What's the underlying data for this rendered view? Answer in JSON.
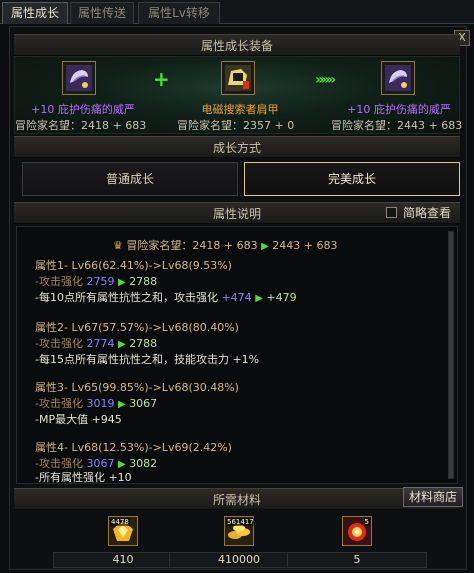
{
  "tabs": [
    {
      "label": "属性成长"
    },
    {
      "label": "属性传送"
    },
    {
      "label": "属性Lv转移"
    }
  ],
  "close_label": "X",
  "equip_section": {
    "title": "属性成长装备",
    "source": {
      "name": "+10 庇护伤痛的威严",
      "plus": "+10",
      "item": "庇护伤痛的威严",
      "fame": "冒险家名望：2418 + 683"
    },
    "material": {
      "name": "电磁搜索者肩甲",
      "fame": "冒险家名望：2357 + 0"
    },
    "result": {
      "name": "+10 庇护伤痛的威严",
      "plus": "+10",
      "item": "庇护伤痛的威严",
      "fame": "冒险家名望：2443 + 683"
    },
    "plus_sign": "+",
    "arrows": "»»»"
  },
  "growth_section": {
    "title": "成长方式",
    "normal_label": "普通成长",
    "perfect_label": "完美成长"
  },
  "desc_section": {
    "title": "属性说明",
    "brief_label": "简略查看",
    "fame_line": {
      "label": "冒险家名望：2418 + 683",
      "arrow": "▶",
      "after": "2443 + 683"
    },
    "attrs": [
      {
        "title": "属性1- Lv66(62.41%)->Lv68(9.53%)",
        "stat": "-攻击强化",
        "from": "2759",
        "to": "2788",
        "note": "-每10点所有属性抗性之和，攻击强化",
        "note_from": "+474",
        "note_to": "+479"
      },
      {
        "title": "属性2- Lv67(57.57%)->Lv68(80.40%)",
        "stat": "-攻击强化",
        "from": "2774",
        "to": "2788",
        "note": "-每15点所有属性抗性之和，技能攻击力 +1%"
      },
      {
        "title": "属性3- Lv65(99.85%)->Lv68(30.48%)",
        "stat": "-攻击强化",
        "from": "3019",
        "to": "3067",
        "note": "-MP最大值 +945"
      },
      {
        "title": "属性4- Lv68(12.53%)->Lv69(2.42%)",
        "stat": "-攻击强化",
        "from": "3067",
        "to": "3082",
        "note": "-所有属性强化 +10"
      }
    ]
  },
  "materials_section": {
    "title": "所需材料",
    "shop_label": "材料商店",
    "items": [
      {
        "badge": "4478",
        "count": "410"
      },
      {
        "badge": "561417",
        "count": "410000"
      },
      {
        "badge": "5",
        "count": "5"
      }
    ]
  },
  "colors": {
    "accent_green": "#4ade3a",
    "item_purple": "#b470ff",
    "item_orange": "#f0a030"
  }
}
